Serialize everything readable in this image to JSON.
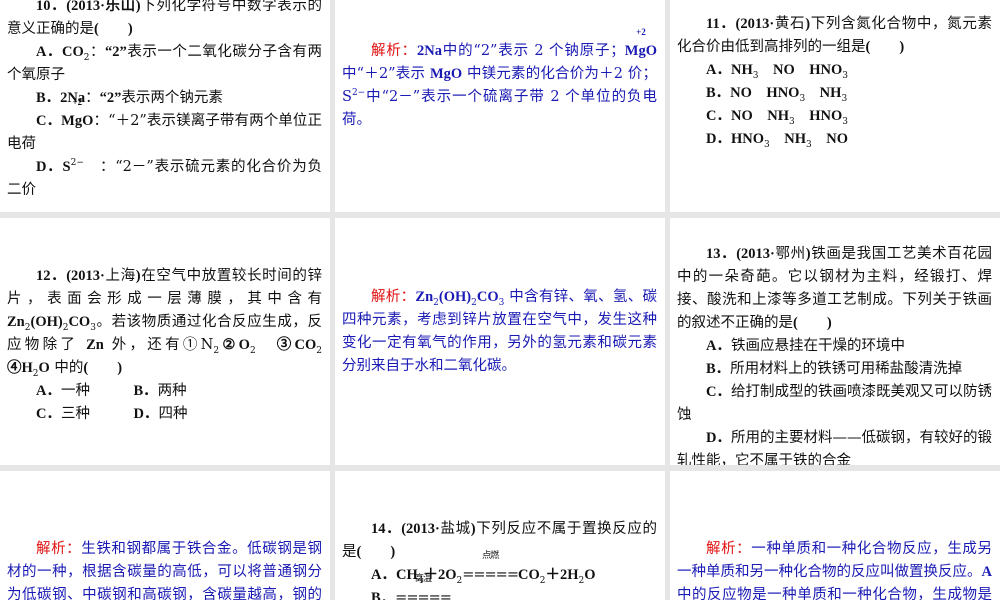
{
  "panels": [
    {
      "id": "q10",
      "blue": false,
      "paras": [
        [
          {
            "t": "10．(2013·乐山)",
            "b": 1
          },
          {
            "t": "下列化学符号中数字表示的意义正确的是"
          },
          {
            "t": "(　　)",
            "b": 1
          }
        ],
        [
          {
            "t": "A．CO",
            "b": 1
          },
          {
            "t": "2",
            "s": "sub"
          },
          {
            "t": "："
          },
          {
            "t": "“2”",
            "b": 1
          },
          {
            "t": "表示一个二氧化碳分子含有两个氧原子"
          }
        ],
        [
          {
            "t": "B．2Na",
            "b": 1
          },
          {
            "t": "："
          },
          {
            "t": "“2”",
            "b": 1
          },
          {
            "t": "表示两个钠元素"
          }
        ],
        [
          {
            "t": "C．",
            "b": 1
          },
          {
            "t": "MgO",
            "b": 1,
            "o": "+2"
          },
          {
            "t": "：“＋2”表示镁离子带有两个单位正电荷"
          }
        ],
        [
          {
            "t": "D．S",
            "b": 1
          },
          {
            "t": "2−",
            "s": "sup"
          },
          {
            "t": "　：“2－”表示硫元素的化合价为负二价"
          }
        ]
      ]
    },
    {
      "id": "a10",
      "blue": true,
      "paras": [
        [
          {
            "t": "解析：",
            "s": "lbl"
          },
          {
            "t": "2Na",
            "b": 1
          },
          {
            "t": "中的“2”表示 2 个钠原子；"
          },
          {
            "t": "MgO",
            "b": 1,
            "o": "+2"
          },
          {
            "t": "中“＋2”表示 "
          },
          {
            "t": "MgO",
            "b": 1
          },
          {
            "t": " 中镁元素的化合价为＋2 价；S"
          },
          {
            "t": "2−",
            "s": "sup"
          },
          {
            "t": "中“2－”表示一个硫离子带 2 个单位的负电荷。"
          }
        ]
      ]
    },
    {
      "id": "q11",
      "blue": false,
      "paras": [
        [
          {
            "t": "11．(2013·",
            "b": 1
          },
          {
            "t": "黄石"
          },
          {
            "t": ")",
            "b": 1
          },
          {
            "t": "下列含氮化合物中，氮元素化合价由低到高排列的一组是"
          },
          {
            "t": "(　　)",
            "b": 1
          }
        ],
        [
          {
            "t": "A．NH",
            "b": 1
          },
          {
            "t": "3",
            "s": "sub"
          },
          {
            "t": "　NO　HNO",
            "b": 1
          },
          {
            "t": "3",
            "s": "sub"
          }
        ],
        [
          {
            "t": "B．NO　HNO",
            "b": 1
          },
          {
            "t": "3",
            "s": "sub"
          },
          {
            "t": "　NH",
            "b": 1
          },
          {
            "t": "3",
            "s": "sub"
          }
        ],
        [
          {
            "t": "C．NO　NH",
            "b": 1
          },
          {
            "t": "3",
            "s": "sub"
          },
          {
            "t": "　HNO",
            "b": 1
          },
          {
            "t": "3",
            "s": "sub"
          }
        ],
        [
          {
            "t": "D．HNO",
            "b": 1
          },
          {
            "t": "3",
            "s": "sub"
          },
          {
            "t": "　NH",
            "b": 1
          },
          {
            "t": "3",
            "s": "sub"
          },
          {
            "t": "　NO",
            "b": 1
          }
        ]
      ]
    },
    {
      "id": "q12",
      "blue": false,
      "paras": [
        [
          {
            "t": "12．(2013·",
            "b": 1
          },
          {
            "t": "上海"
          },
          {
            "t": ")",
            "b": 1
          },
          {
            "t": "在空气中放置较长时间的锌片，表面会形成一层薄膜，其中含有 "
          },
          {
            "t": "Zn",
            "b": 1
          },
          {
            "t": "2",
            "s": "sub"
          },
          {
            "t": "(OH)",
            "b": 1
          },
          {
            "t": "2",
            "s": "sub"
          },
          {
            "t": "CO",
            "b": 1
          },
          {
            "t": "3",
            "s": "sub"
          },
          {
            "t": "。若该物质通过化合反应生成，反应物除了 "
          },
          {
            "t": "Zn",
            "b": 1
          },
          {
            "t": " 外，还有①N",
            "b": 0
          },
          {
            "t": "2",
            "s": "sub"
          },
          {
            "t": "②O",
            "b": 1
          },
          {
            "t": "2",
            "s": "sub"
          },
          {
            "t": "　③CO",
            "b": 1
          },
          {
            "t": "2",
            "s": "sub"
          },
          {
            "t": "　④H",
            "b": 1
          },
          {
            "t": "2",
            "s": "sub"
          },
          {
            "t": "O",
            "b": 1
          },
          {
            "t": " 中的"
          },
          {
            "t": "(　　)",
            "b": 1
          }
        ],
        [
          {
            "t": "A．",
            "b": 1
          },
          {
            "t": "一种　　　"
          },
          {
            "t": "B．",
            "b": 1
          },
          {
            "t": "两种"
          }
        ],
        [
          {
            "t": "C．",
            "b": 1
          },
          {
            "t": "三种　　　"
          },
          {
            "t": "D．",
            "b": 1
          },
          {
            "t": "四种"
          }
        ]
      ]
    },
    {
      "id": "a12",
      "blue": true,
      "paras": [
        [
          {
            "t": "解析：",
            "s": "lbl"
          },
          {
            "t": "Zn",
            "b": 1
          },
          {
            "t": "2",
            "s": "sub"
          },
          {
            "t": "(OH)",
            "b": 1
          },
          {
            "t": "2",
            "s": "sub"
          },
          {
            "t": "CO",
            "b": 1
          },
          {
            "t": "3",
            "s": "sub"
          },
          {
            "t": " 中含有锌、氧、氢、碳四种元素，考虑到锌片放置在空气中，发生这种变化一定有氧气的作用，另外的氢元素和碳元素分别来自于水和二氧化碳。"
          }
        ]
      ]
    },
    {
      "id": "q13",
      "blue": false,
      "paras": [
        [
          {
            "t": "13．(2013·",
            "b": 1
          },
          {
            "t": "鄂州"
          },
          {
            "t": ")",
            "b": 1
          },
          {
            "t": "铁画是我国工艺美术百花园中的一朵奇葩。它以钢材为主料，经锻打、焊接、酸洗和上漆等多道工艺制成。下列关于铁画的叙述不正确的是"
          },
          {
            "t": "(　　)",
            "b": 1
          }
        ],
        [
          {
            "t": "A．",
            "b": 1
          },
          {
            "t": "铁画应悬挂在干燥的环境中"
          }
        ],
        [
          {
            "t": "B．",
            "b": 1
          },
          {
            "t": "所用材料上的铁锈可用稀盐酸清洗掉"
          }
        ],
        [
          {
            "t": "C．",
            "b": 1
          },
          {
            "t": "给打制成型的铁画喷漆既美观又可以防锈蚀"
          }
        ],
        [
          {
            "t": "D．",
            "b": 1
          },
          {
            "t": "所用的主要材料——低碳钢，有较好的锻轧性能，它不属于铁的合金"
          }
        ]
      ]
    },
    {
      "id": "a13",
      "blue": true,
      "paras": [
        [
          {
            "t": "解析：",
            "s": "lbl"
          },
          {
            "t": "生铁和钢都属于铁合金。低碳钢是钢材的一种，根据含碳量的高低，可以将普通钢分为低碳钢、中碳钢和高碳钢，含碳量越高，钢的硬度越大，含碳"
          }
        ]
      ]
    },
    {
      "id": "q14",
      "blue": false,
      "paras": [
        [
          {
            "t": "14．(2013·",
            "b": 1
          },
          {
            "t": "盐城"
          },
          {
            "t": ")",
            "b": 1
          },
          {
            "t": "下列反应不属于置换反应的是"
          },
          {
            "t": "(　　)",
            "b": 1
          }
        ],
        [
          {
            "t": "A．CH",
            "b": 1
          },
          {
            "t": "4",
            "s": "sub"
          },
          {
            "t": "＋2O",
            "b": 1
          },
          {
            "t": "2",
            "s": "sub"
          },
          {
            "t": "=====",
            "o": "点燃",
            "eq": 1
          },
          {
            "t": "CO",
            "b": 1
          },
          {
            "t": "2",
            "s": "sub"
          },
          {
            "t": "＋2H",
            "b": 1
          },
          {
            "t": "2",
            "s": "sub"
          },
          {
            "t": "O",
            "b": 1
          }
        ],
        [
          {
            "t": "B．",
            "b": 1
          },
          {
            "t": "=====",
            "o": "高温",
            "eq": 1
          }
        ]
      ]
    },
    {
      "id": "a14",
      "blue": true,
      "paras": [
        [
          {
            "t": "解析：",
            "s": "lbl"
          },
          {
            "t": "一种单质和一种化合物反应，生成另一种单质和另一种化合物的反应叫做置换反应。"
          },
          {
            "t": "A",
            "b": 1
          },
          {
            "t": " 中的反应物是一种单质和一种化合物，生成物是两种化合物，"
          }
        ]
      ]
    }
  ]
}
